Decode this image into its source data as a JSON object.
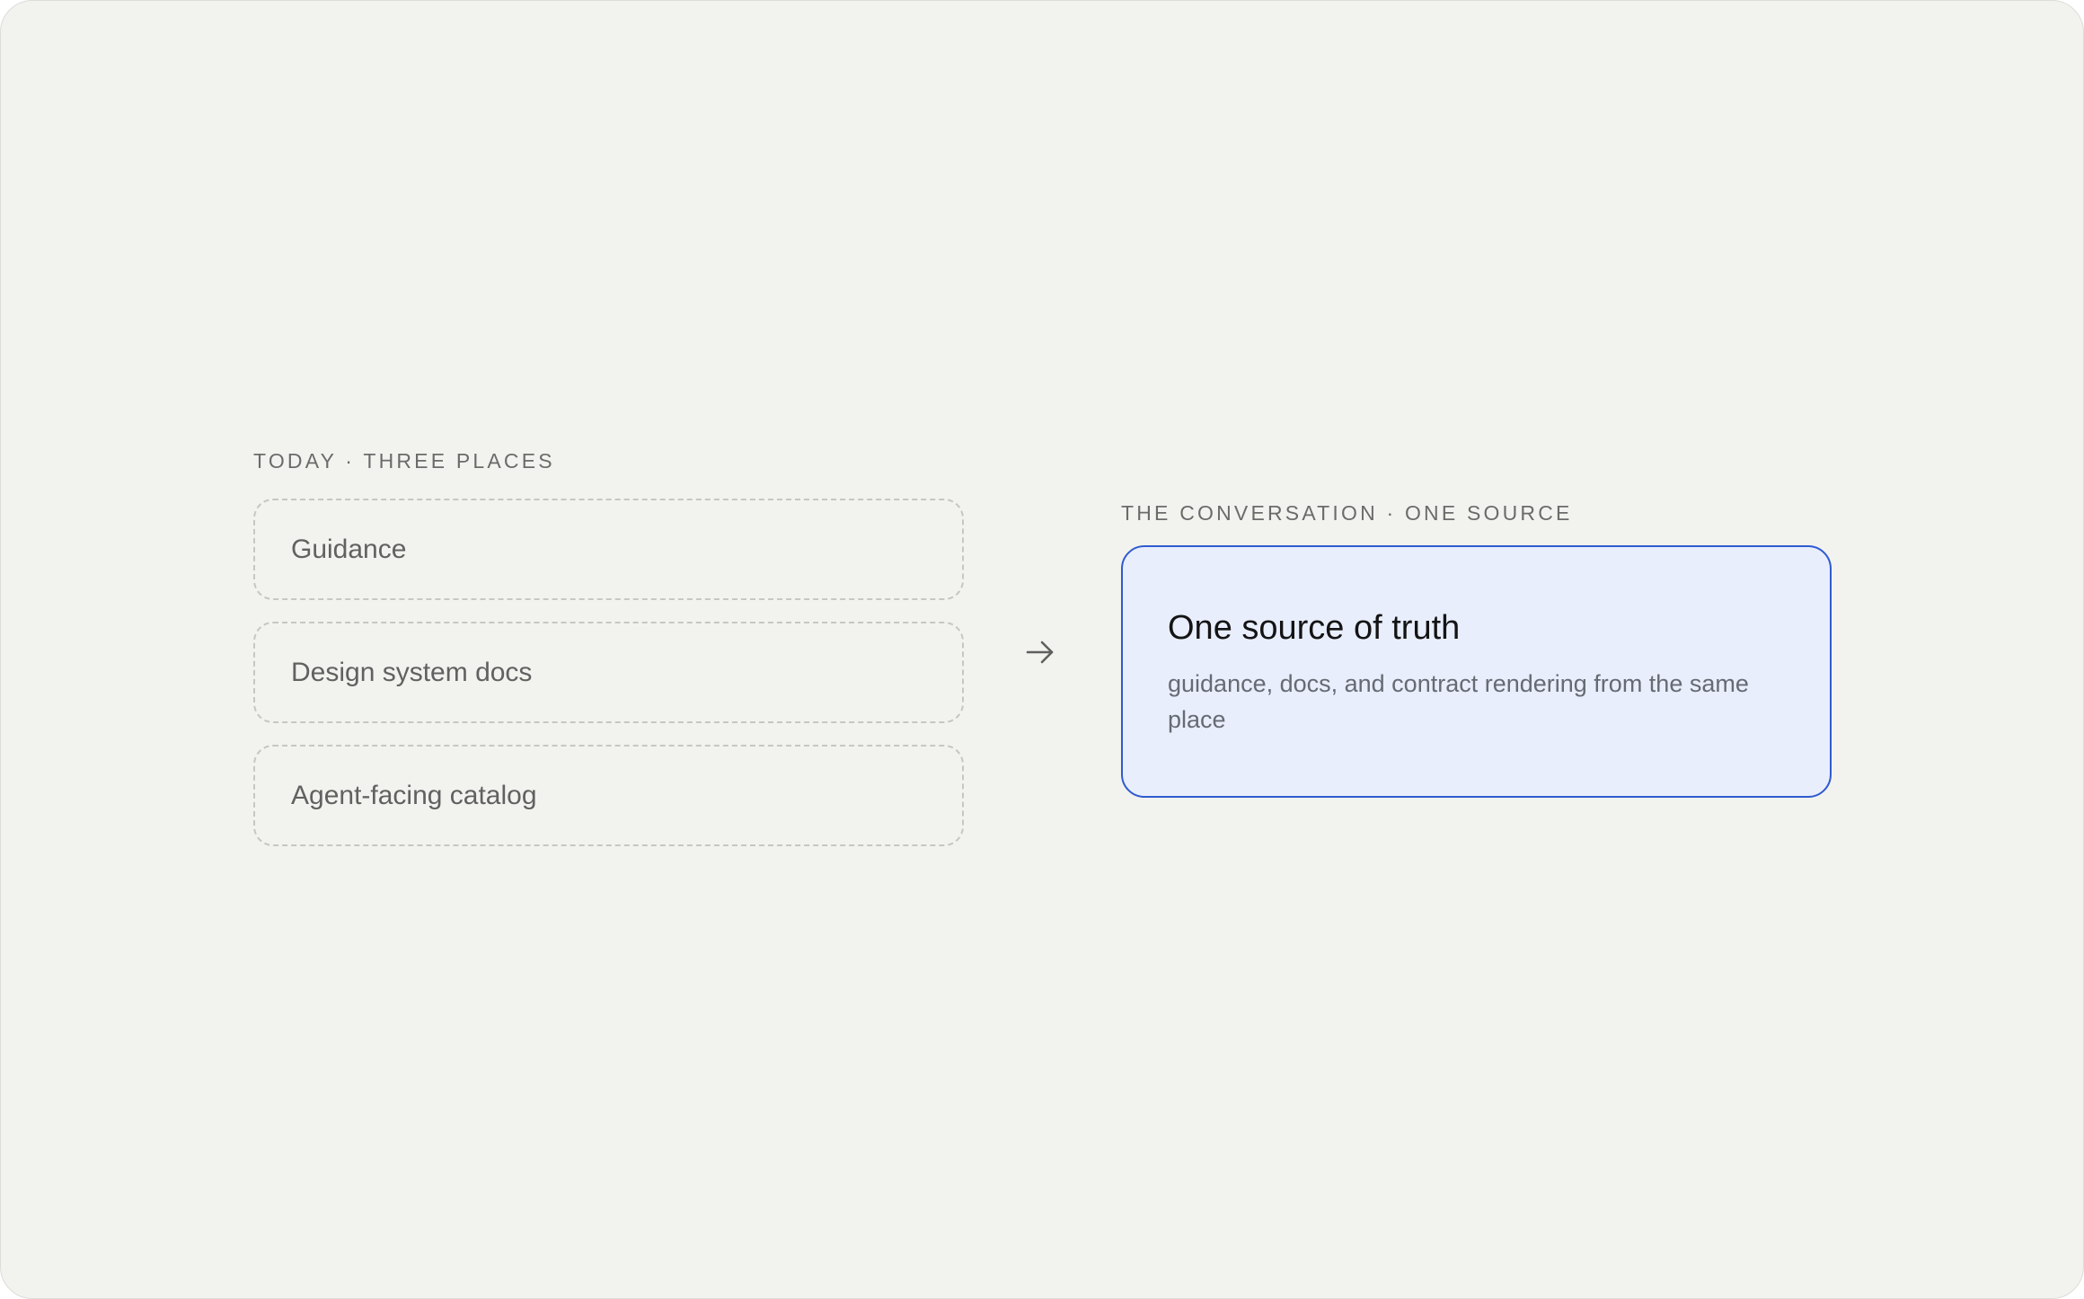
{
  "today": {
    "eyebrow": "TODAY · THREE PLACES",
    "places": [
      "Guidance",
      "Design system docs",
      "Agent-facing catalog"
    ]
  },
  "arrow_icon": "arrow-right-icon",
  "conversation": {
    "eyebrow": "THE CONVERSATION · ONE SOURCE",
    "card_title": "One source of truth",
    "card_description": "guidance, docs, and contract rendering from the same place"
  },
  "colors": {
    "background": "#f2f2ef",
    "card_fill": "#e8eefc",
    "card_border": "#2f5bd0",
    "dashed_border": "#c6c6c2"
  }
}
